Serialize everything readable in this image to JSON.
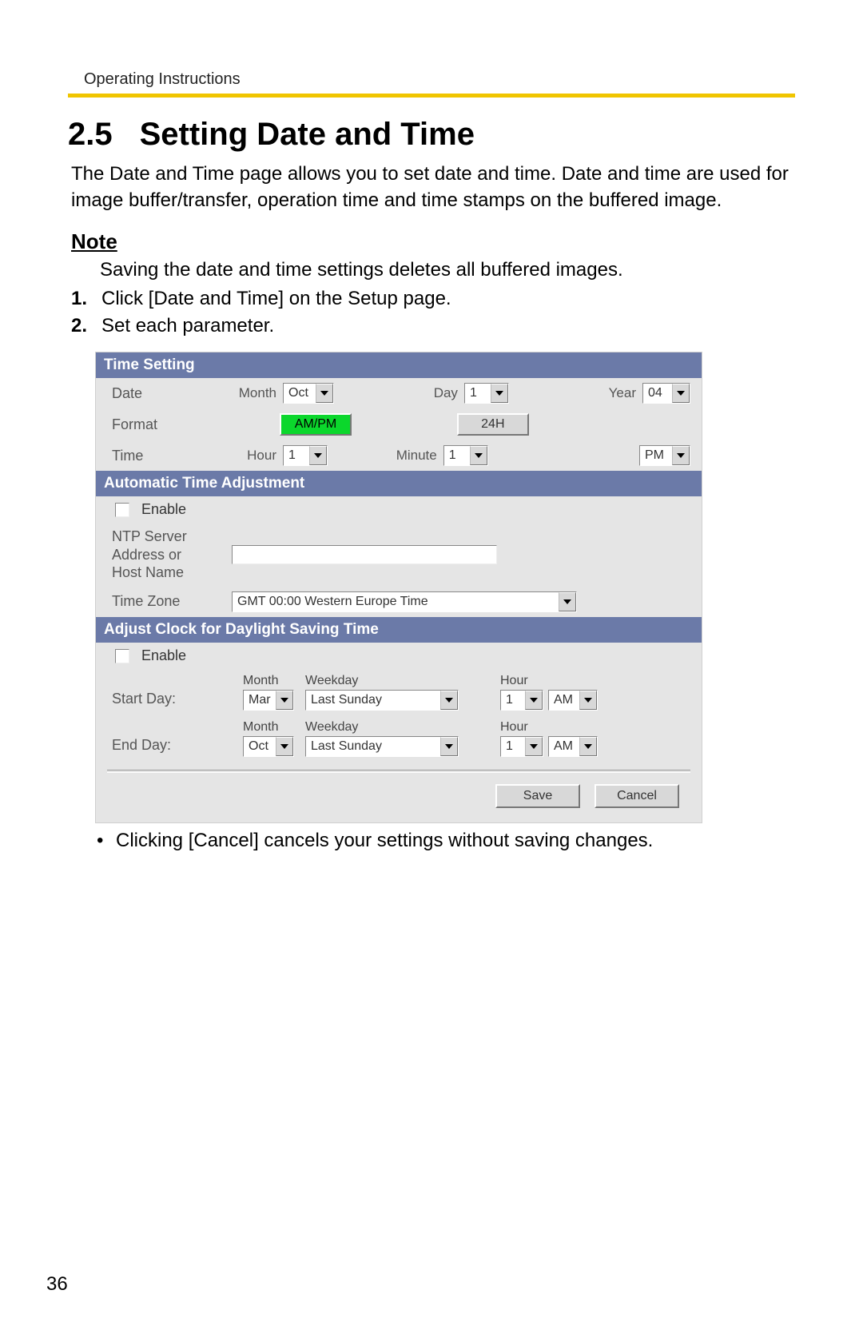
{
  "header": {
    "running_head": "Operating Instructions"
  },
  "section": {
    "number": "2.5",
    "title": "Setting Date and Time",
    "intro": "The Date and Time page allows you to set date and time. Date and time are used for image buffer/transfer, operation time and time stamps on the buffered image."
  },
  "note": {
    "label": "Note",
    "text": "Saving the date and time settings deletes all buffered images."
  },
  "steps": {
    "s1_num": "1.",
    "s1_text": "Click [Date and Time] on the Setup page.",
    "s2_num": "2.",
    "s2_text": "Set each parameter."
  },
  "panel": {
    "time_setting": {
      "bar": "Time Setting",
      "date_label": "Date",
      "month_label": "Month",
      "month_value": "Oct",
      "day_label": "Day",
      "day_value": "1",
      "year_label": "Year",
      "year_value": "04",
      "format_label": "Format",
      "format_ampm": "AM/PM",
      "format_24h": "24H",
      "time_label": "Time",
      "hour_label": "Hour",
      "hour_value": "1",
      "minute_label": "Minute",
      "minute_value": "1",
      "ampm_value": "PM"
    },
    "auto_adj": {
      "bar": "Automatic Time Adjustment",
      "enable_label": "Enable",
      "ntp_label_l1": "NTP Server",
      "ntp_label_l2": "Address or",
      "ntp_label_l3": "Host Name",
      "tz_label": "Time Zone",
      "tz_value": "GMT 00:00 Western Europe Time"
    },
    "dst": {
      "bar": "Adjust Clock for Daylight Saving Time",
      "enable_label": "Enable",
      "start_label": "Start Day:",
      "end_label": "End Day:",
      "month_head": "Month",
      "weekday_head": "Weekday",
      "hour_head": "Hour",
      "start_month": "Mar",
      "start_weekday": "Last Sunday",
      "start_hour": "1",
      "start_ampm": "AM",
      "end_month": "Oct",
      "end_weekday": "Last Sunday",
      "end_hour": "1",
      "end_ampm": "AM"
    },
    "buttons": {
      "save": "Save",
      "cancel": "Cancel"
    }
  },
  "footnote": "Clicking [Cancel] cancels your settings without saving changes.",
  "page_number": "36"
}
